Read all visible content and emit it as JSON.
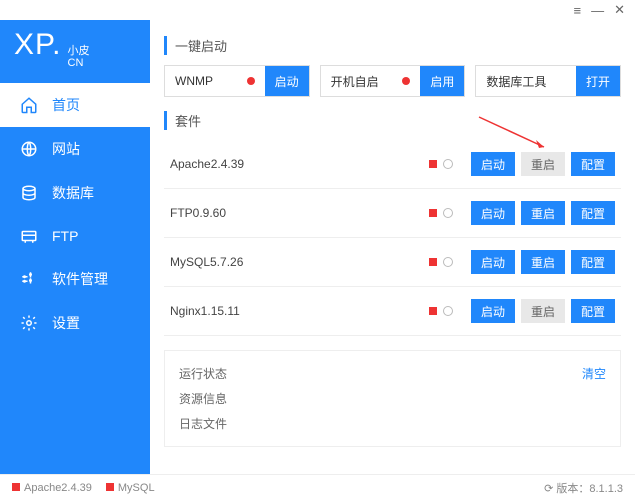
{
  "logo": {
    "xp": "XP.",
    "line1": "小皮",
    "line2": "CN"
  },
  "nav": [
    {
      "label": "首页",
      "icon": "home"
    },
    {
      "label": "网站",
      "icon": "globe"
    },
    {
      "label": "数据库",
      "icon": "db"
    },
    {
      "label": "FTP",
      "icon": "ftp"
    },
    {
      "label": "软件管理",
      "icon": "sw"
    },
    {
      "label": "设置",
      "icon": "gear"
    }
  ],
  "sections": {
    "quick": "一键启动",
    "suite": "套件"
  },
  "quick": [
    {
      "label": "WNMP",
      "dot": true,
      "btn": "启动"
    },
    {
      "label": "开机自启",
      "dot": true,
      "btn": "启用"
    },
    {
      "label": "数据库工具",
      "dot": false,
      "btn": "打开"
    }
  ],
  "services": [
    {
      "name": "Apache2.4.39",
      "btns": [
        "启动",
        "重启",
        "配置"
      ],
      "styles": [
        "p",
        "s",
        "p"
      ]
    },
    {
      "name": "FTP0.9.60",
      "btns": [
        "启动",
        "重启",
        "配置"
      ],
      "styles": [
        "p",
        "p",
        "p"
      ]
    },
    {
      "name": "MySQL5.7.26",
      "btns": [
        "启动",
        "重启",
        "配置"
      ],
      "styles": [
        "p",
        "p",
        "p"
      ]
    },
    {
      "name": "Nginx1.15.11",
      "btns": [
        "启动",
        "重启",
        "配置"
      ],
      "styles": [
        "p",
        "s",
        "p"
      ]
    }
  ],
  "info": {
    "status": "运行状态",
    "resource": "资源信息",
    "logs": "日志文件",
    "clear": "清空"
  },
  "footer": {
    "items": [
      "Apache2.4.39",
      "MySQL"
    ],
    "version_label": "版本：",
    "version": "8.1.1.3"
  }
}
